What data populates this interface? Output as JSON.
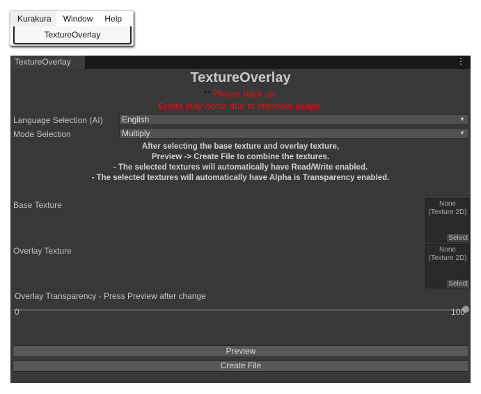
{
  "menu": {
    "items": [
      "Kurakura",
      "Window",
      "Help"
    ],
    "dropdown_item": "TextureOverlay"
  },
  "window": {
    "tab": "TextureOverlay",
    "title": "TextureOverlay",
    "warning_prefix": "**",
    "warning1": "Please back up.",
    "warning2": "Errors may occur due to improper usage.",
    "language_label": "Language Selection (AI)",
    "language_value": "English",
    "mode_label": "Mode Selection",
    "mode_value": "Multiply",
    "info": [
      "After selecting the base texture and overlay texture,",
      "Preview -> Create File to combine the textures.",
      "- The selected textures will automatically have Read/Write enabled.",
      "- The selected textures will automatically have Alpha is Transparency enabled."
    ],
    "base_label": "Base Texture",
    "overlay_label": "Overlay Texture",
    "none_text": "None",
    "type_text": "(Texture 2D)",
    "select_label": "Select",
    "transparency_label": "Overlay Transparency - Press Preview after change",
    "slider_min": "0",
    "slider_max": "100",
    "slider_value": 100,
    "preview_label": "Preview",
    "create_label": "Create File"
  }
}
